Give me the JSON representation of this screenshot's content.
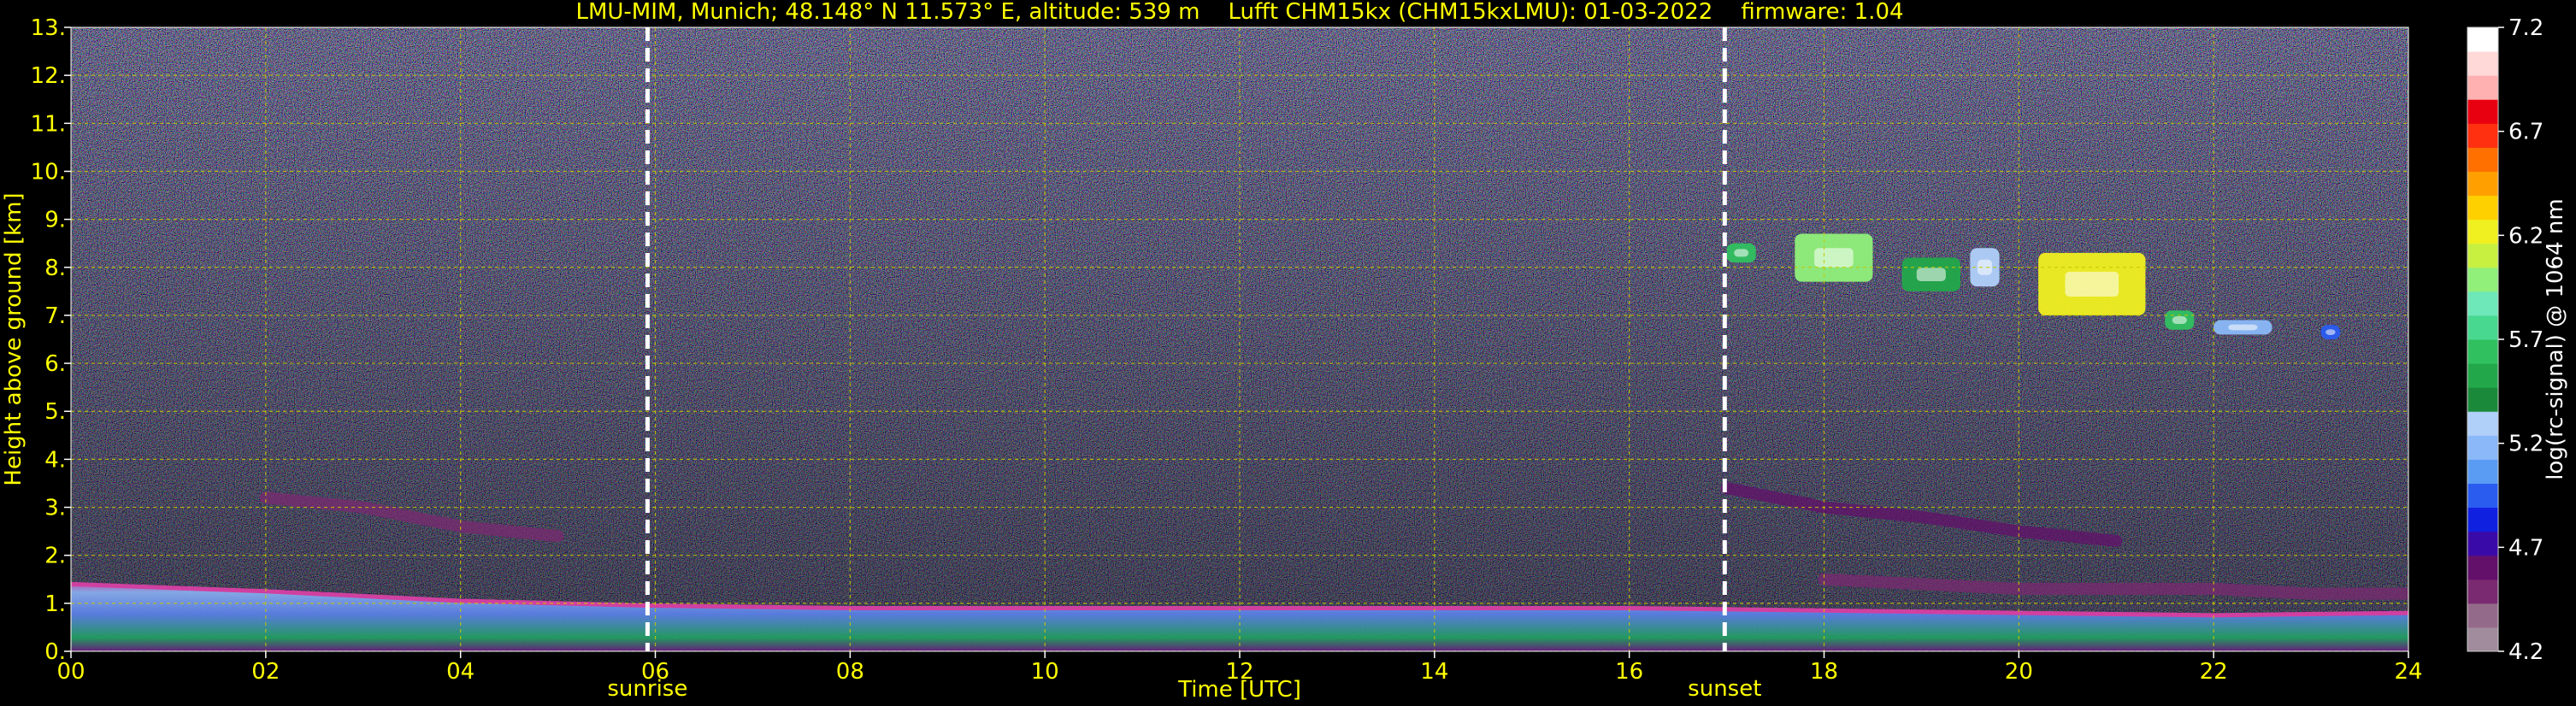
{
  "chart_data": {
    "type": "heatmap",
    "title": "LMU-MIM, Munich; 48.148° N 11.573° E, altitude: 539 m    Lufft CHM15kx (CHM15kxLMU): 01-03-2022    firmware: 1.04",
    "xlabel": "Time [UTC]",
    "ylabel": "Height above ground [km]",
    "xlim": [
      0,
      24
    ],
    "ylim": [
      0,
      13
    ],
    "x_ticks": [
      "00",
      "02",
      "04",
      "06",
      "08",
      "10",
      "12",
      "14",
      "16",
      "18",
      "20",
      "22",
      "24"
    ],
    "y_ticks": [
      "0.",
      "1.",
      "2.",
      "3.",
      "4.",
      "5.",
      "6.",
      "7.",
      "8.",
      "9.",
      "10.",
      "11.",
      "12.",
      "13."
    ],
    "grid": true,
    "events": [
      {
        "label": "sunrise",
        "time": 5.92
      },
      {
        "label": "sunset",
        "time": 16.98
      }
    ],
    "colorbar": {
      "label": "log(rc-signal) @ 1064 nm",
      "range": [
        4.2,
        7.2
      ],
      "ticks": [
        "4.2",
        "4.7",
        "5.2",
        "5.7",
        "6.2",
        "6.7",
        "7.2"
      ],
      "colors": [
        "#a08c9c",
        "#946a8a",
        "#7a2a70",
        "#62106a",
        "#3a0aa8",
        "#1020e0",
        "#2a5cf0",
        "#5a9cf4",
        "#8ab8f8",
        "#b0d0fa",
        "#1a8a3a",
        "#22a84a",
        "#30c060",
        "#48d890",
        "#6ee8b8",
        "#90f07a",
        "#c8f040",
        "#f0f020",
        "#ffd000",
        "#ffa000",
        "#ff7000",
        "#ff3010",
        "#e80010",
        "#ffb0b0",
        "#ffd8d8",
        "#ffffff"
      ]
    },
    "layers": [
      {
        "name": "boundary-layer",
        "x": [
          0,
          2,
          4,
          6,
          8,
          10,
          12,
          14,
          16,
          18,
          20,
          22,
          24
        ],
        "y": [
          1.4,
          1.25,
          1.05,
          0.95,
          0.9,
          0.9,
          0.9,
          0.9,
          0.9,
          0.85,
          0.8,
          0.75,
          0.8
        ],
        "level": 4.9
      },
      {
        "name": "residual-layer",
        "x": [
          2,
          3,
          4,
          5
        ],
        "y": [
          3.2,
          3.0,
          2.6,
          2.4
        ],
        "level": 4.5
      },
      {
        "name": "residual-layer",
        "x": [
          17,
          18,
          19,
          20,
          21
        ],
        "y": [
          3.4,
          3.0,
          2.8,
          2.5,
          2.3
        ],
        "level": 4.6
      },
      {
        "name": "evening-layer",
        "x": [
          18,
          19,
          20,
          21,
          22,
          23,
          24
        ],
        "y": [
          1.5,
          1.4,
          1.3,
          1.3,
          1.3,
          1.2,
          1.2
        ],
        "level": 4.5
      }
    ],
    "clouds": [
      {
        "x": [
          17.0,
          17.3
        ],
        "y": [
          8.1,
          8.5
        ],
        "level": 5.6
      },
      {
        "x": [
          17.7,
          18.5
        ],
        "y": [
          7.7,
          8.7
        ],
        "level": 6.0
      },
      {
        "x": [
          18.8,
          19.4
        ],
        "y": [
          7.5,
          8.2
        ],
        "level": 5.5
      },
      {
        "x": [
          19.5,
          19.8
        ],
        "y": [
          7.6,
          8.4
        ],
        "level": 5.3
      },
      {
        "x": [
          20.2,
          21.3
        ],
        "y": [
          7.0,
          8.3
        ],
        "level": 6.2
      },
      {
        "x": [
          21.5,
          21.8
        ],
        "y": [
          6.7,
          7.1
        ],
        "level": 5.6
      },
      {
        "x": [
          22.0,
          22.6
        ],
        "y": [
          6.6,
          6.9
        ],
        "level": 5.2
      },
      {
        "x": [
          23.1,
          23.3
        ],
        "y": [
          6.5,
          6.8
        ],
        "level": 4.9
      }
    ]
  }
}
